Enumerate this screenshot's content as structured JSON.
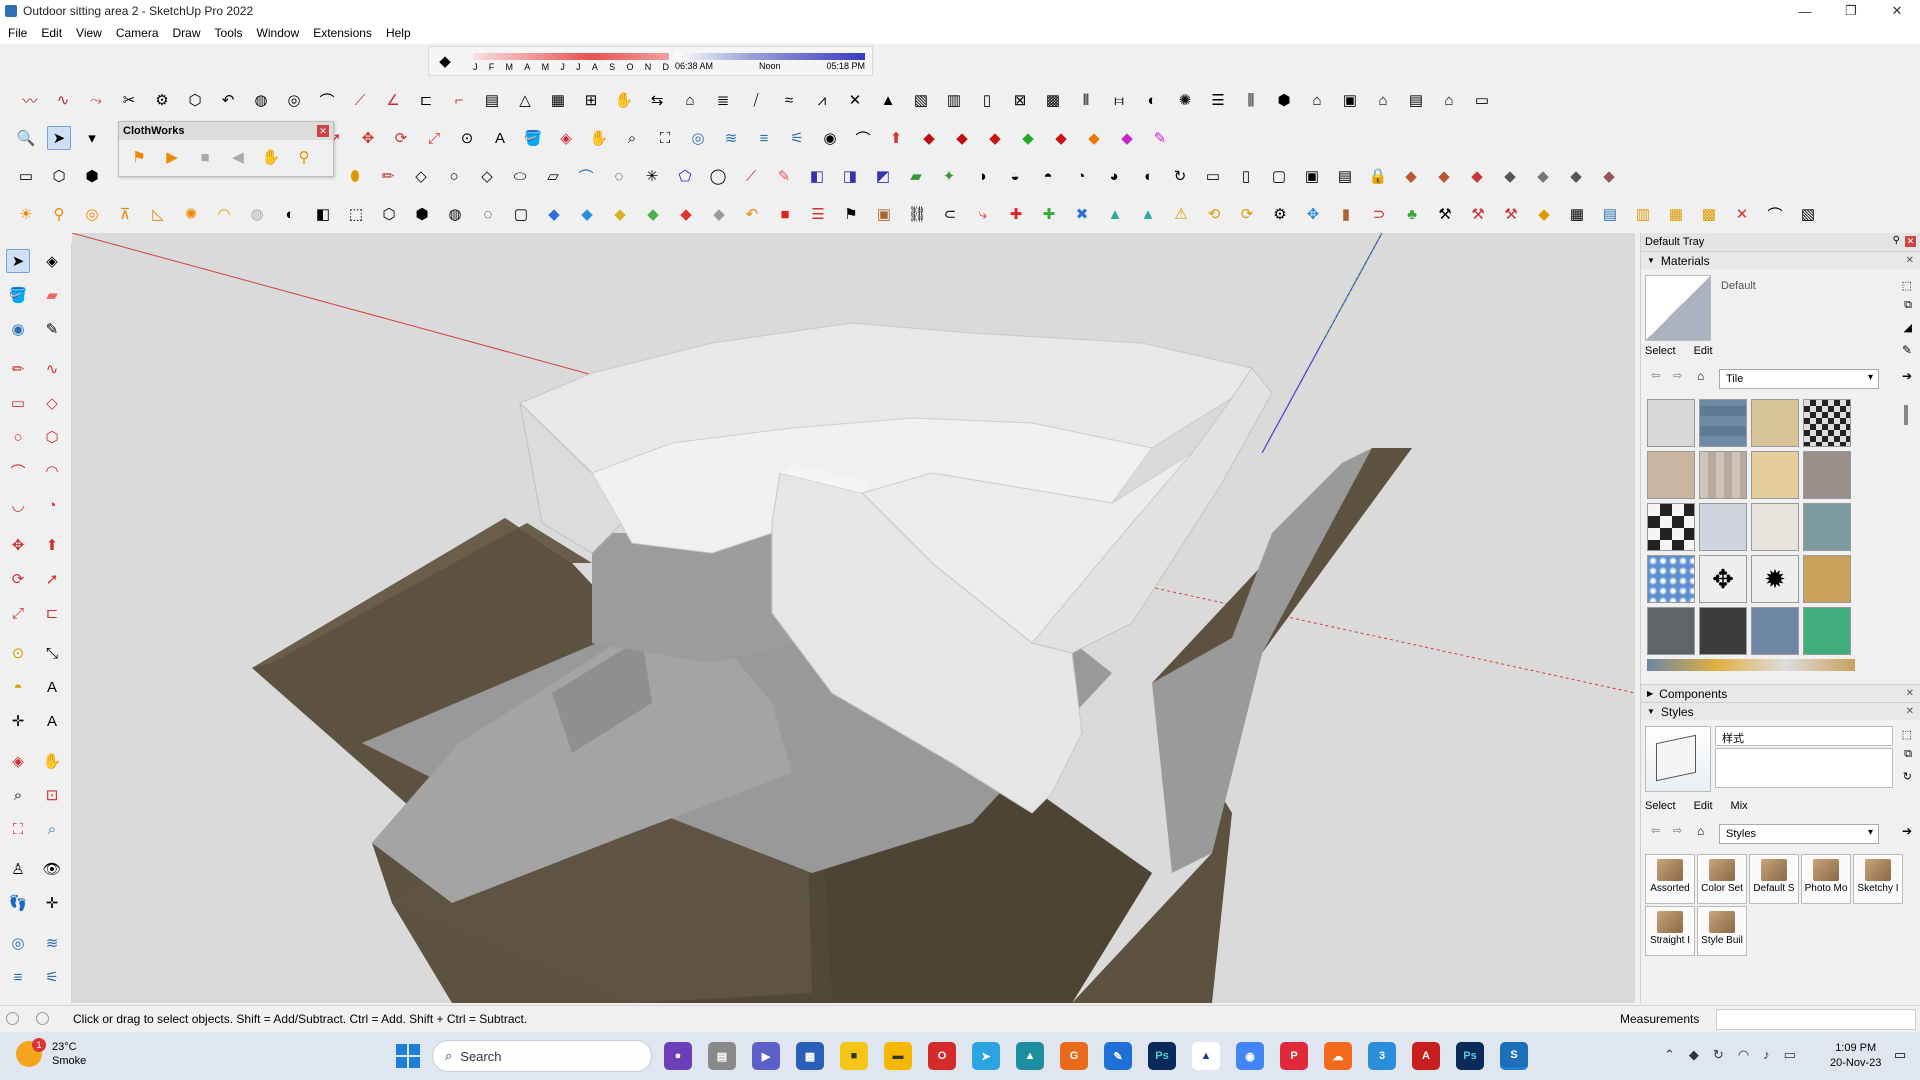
{
  "window": {
    "title": "Outdoor sitting area 2 - SketchUp Pro 2022",
    "controls": [
      "—",
      "❐",
      "✕"
    ]
  },
  "menu": [
    "File",
    "Edit",
    "View",
    "Camera",
    "Draw",
    "Tools",
    "Window",
    "Extensions",
    "Help"
  ],
  "shadow": {
    "months": [
      "J",
      "F",
      "M",
      "A",
      "M",
      "J",
      "J",
      "A",
      "S",
      "O",
      "N",
      "D"
    ],
    "time_start": "06:38 AM",
    "time_mid": "Noon",
    "time_end": "05:18 PM"
  },
  "clothworks": {
    "title": "ClothWorks"
  },
  "tray": {
    "title": "Default Tray",
    "materials": {
      "header": "Materials",
      "name": "Default",
      "tab_select": "Select",
      "tab_edit": "Edit",
      "library": "Tile"
    },
    "components": {
      "header": "Components"
    },
    "styles": {
      "header": "Styles",
      "name": "样式",
      "tab_select": "Select",
      "tab_edit": "Edit",
      "tab_mix": "Mix",
      "library": "Styles",
      "items": [
        "Assorted",
        "Color Set",
        "Default S",
        "Photo Mo",
        "Sketchy I",
        "Straight I",
        "Style Buil"
      ]
    }
  },
  "status": {
    "hint": "Click or drag to select objects. Shift = Add/Subtract. Ctrl = Add. Shift + Ctrl = Subtract.",
    "measurements_label": "Measurements",
    "measurements_value": ""
  },
  "taskbar": {
    "weather_temp": "23°C",
    "weather_desc": "Smoke",
    "weather_badge": "1",
    "search": "Search",
    "time": "1:09 PM",
    "date": "20-Nov-23"
  },
  "colors": {
    "accent": "#1e7fd8",
    "planter": "#5b503f",
    "gravel": "#9a9a9a",
    "cushion": "#e8e8e8",
    "ground": "#d9d9d9"
  }
}
